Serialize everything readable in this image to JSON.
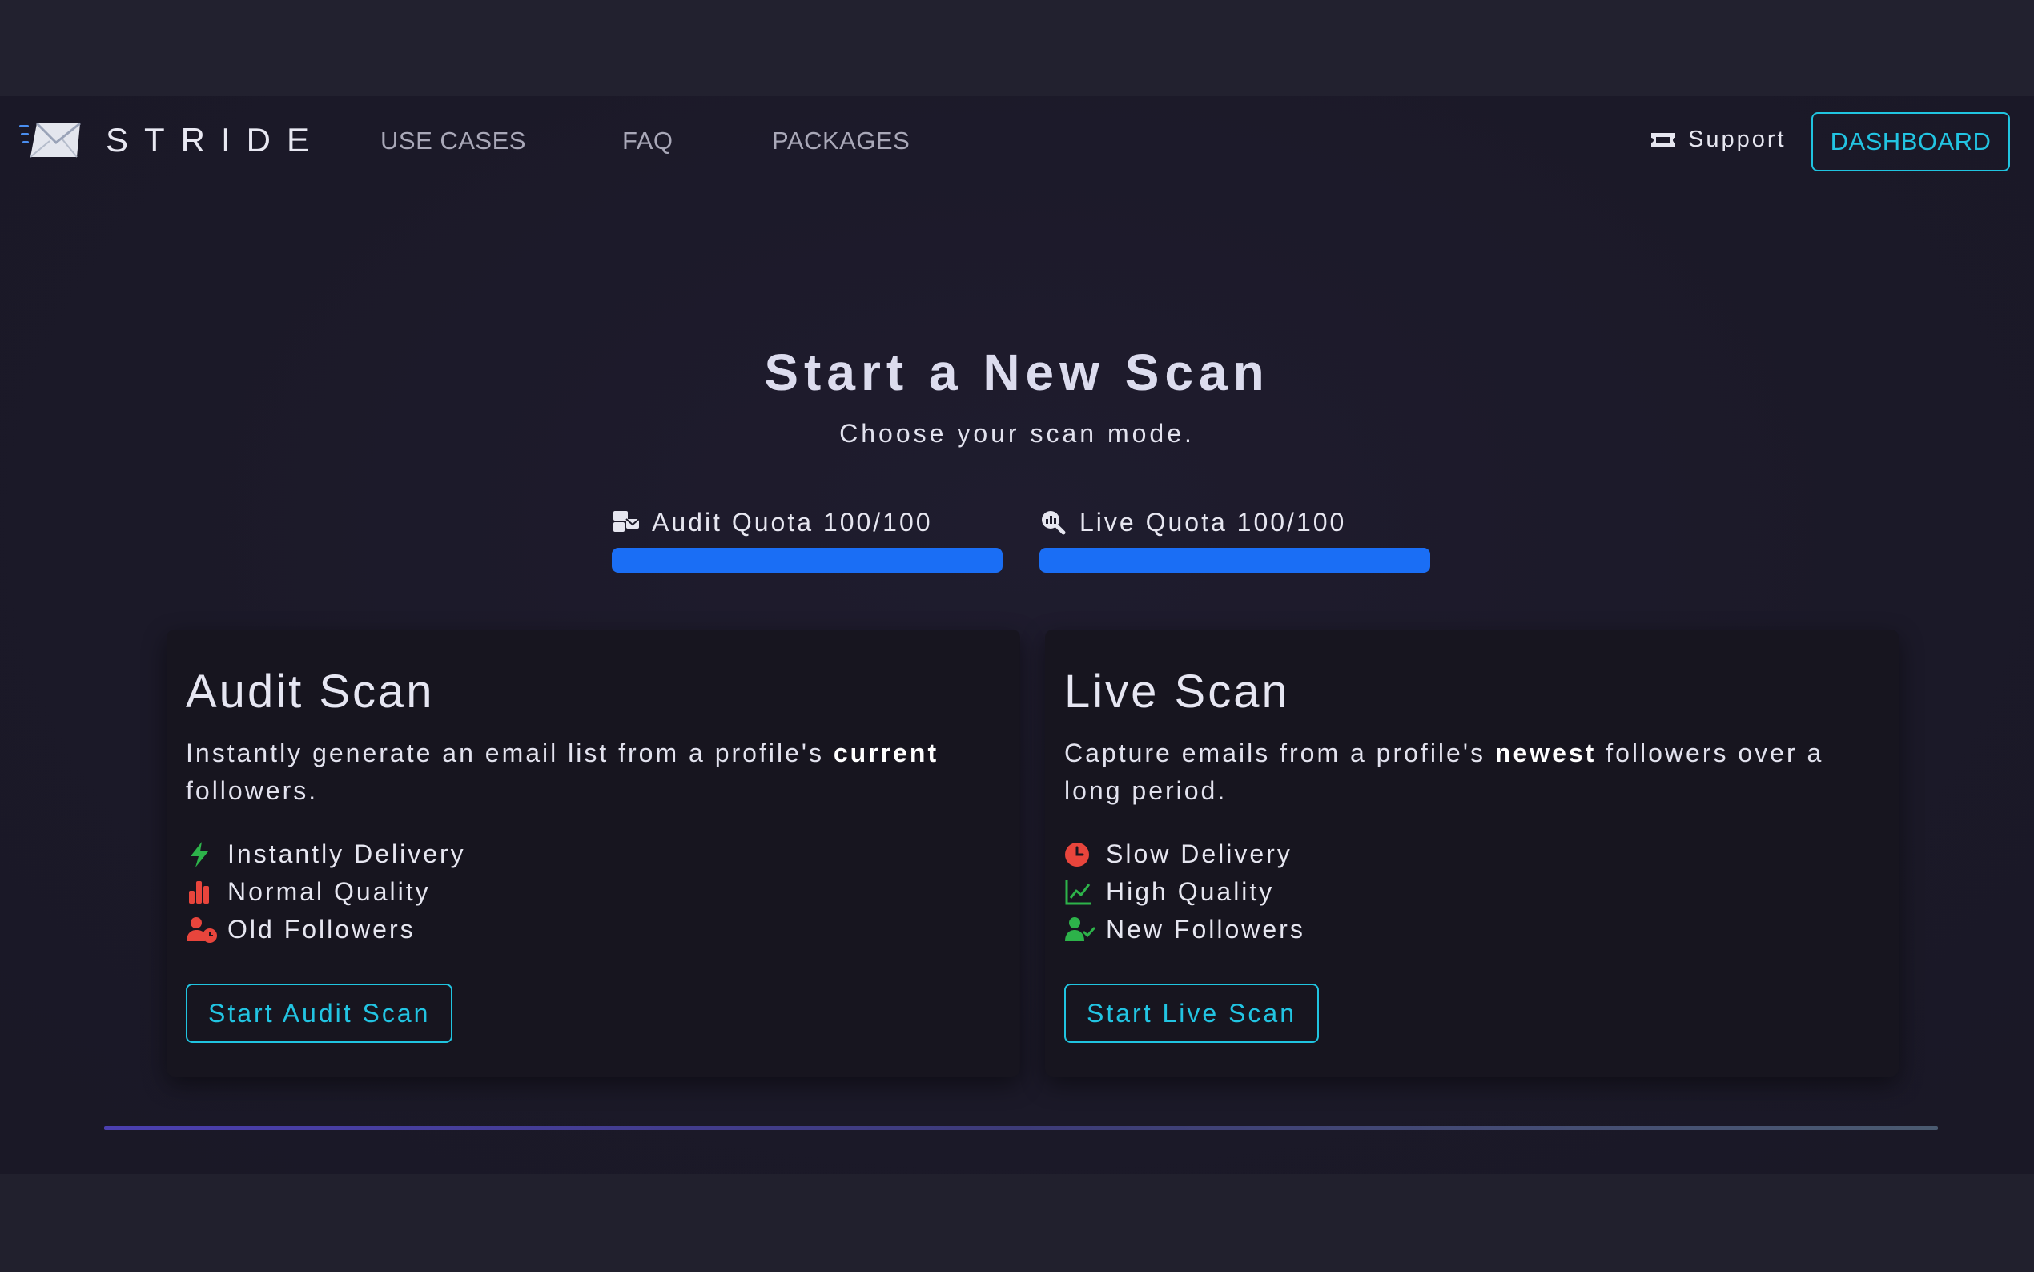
{
  "brand": {
    "name": "STRIDE",
    "logo_icon": "envelope-icon"
  },
  "nav": {
    "links": [
      "USE CASES",
      "FAQ",
      "PACKAGES"
    ],
    "support_label": "Support",
    "support_icon": "ticket-icon",
    "dashboard_label": "DASHBOARD"
  },
  "hero": {
    "title": "Start a New Scan",
    "subtitle": "Choose your scan mode."
  },
  "quotas": {
    "audit": {
      "label": "Audit Quota 100/100",
      "fraction": 1.0,
      "icon": "mail-bulk-icon"
    },
    "live": {
      "label": "Live Quota 100/100",
      "fraction": 1.0,
      "icon": "search-chart-icon"
    }
  },
  "cards": {
    "audit": {
      "title": "Audit Scan",
      "desc_before": "Instantly generate an email list from a profile's ",
      "desc_bold": "current",
      "desc_after": " followers.",
      "features": [
        {
          "label": "Instantly Delivery",
          "icon": "bolt-icon",
          "color": "#2db34a"
        },
        {
          "label": "Normal Quality",
          "icon": "bar-chart-icon",
          "color": "#e8453c"
        },
        {
          "label": "Old Followers",
          "icon": "user-clock-icon",
          "color": "#e8453c"
        }
      ],
      "button_label": "Start Audit Scan"
    },
    "live": {
      "title": "Live Scan",
      "desc_before": "Capture emails from a profile's ",
      "desc_bold": "newest",
      "desc_after": " followers over a long period.",
      "features": [
        {
          "label": "Slow Delivery",
          "icon": "clock-icon",
          "color": "#e8453c"
        },
        {
          "label": "High Quality",
          "icon": "line-chart-icon",
          "color": "#2db34a"
        },
        {
          "label": "New Followers",
          "icon": "user-check-icon",
          "color": "#2db34a"
        }
      ],
      "button_label": "Start Live Scan"
    }
  },
  "colors": {
    "accent": "#22c4e2",
    "progress": "#1a6ef5",
    "good": "#2db34a",
    "bad": "#e8453c"
  }
}
